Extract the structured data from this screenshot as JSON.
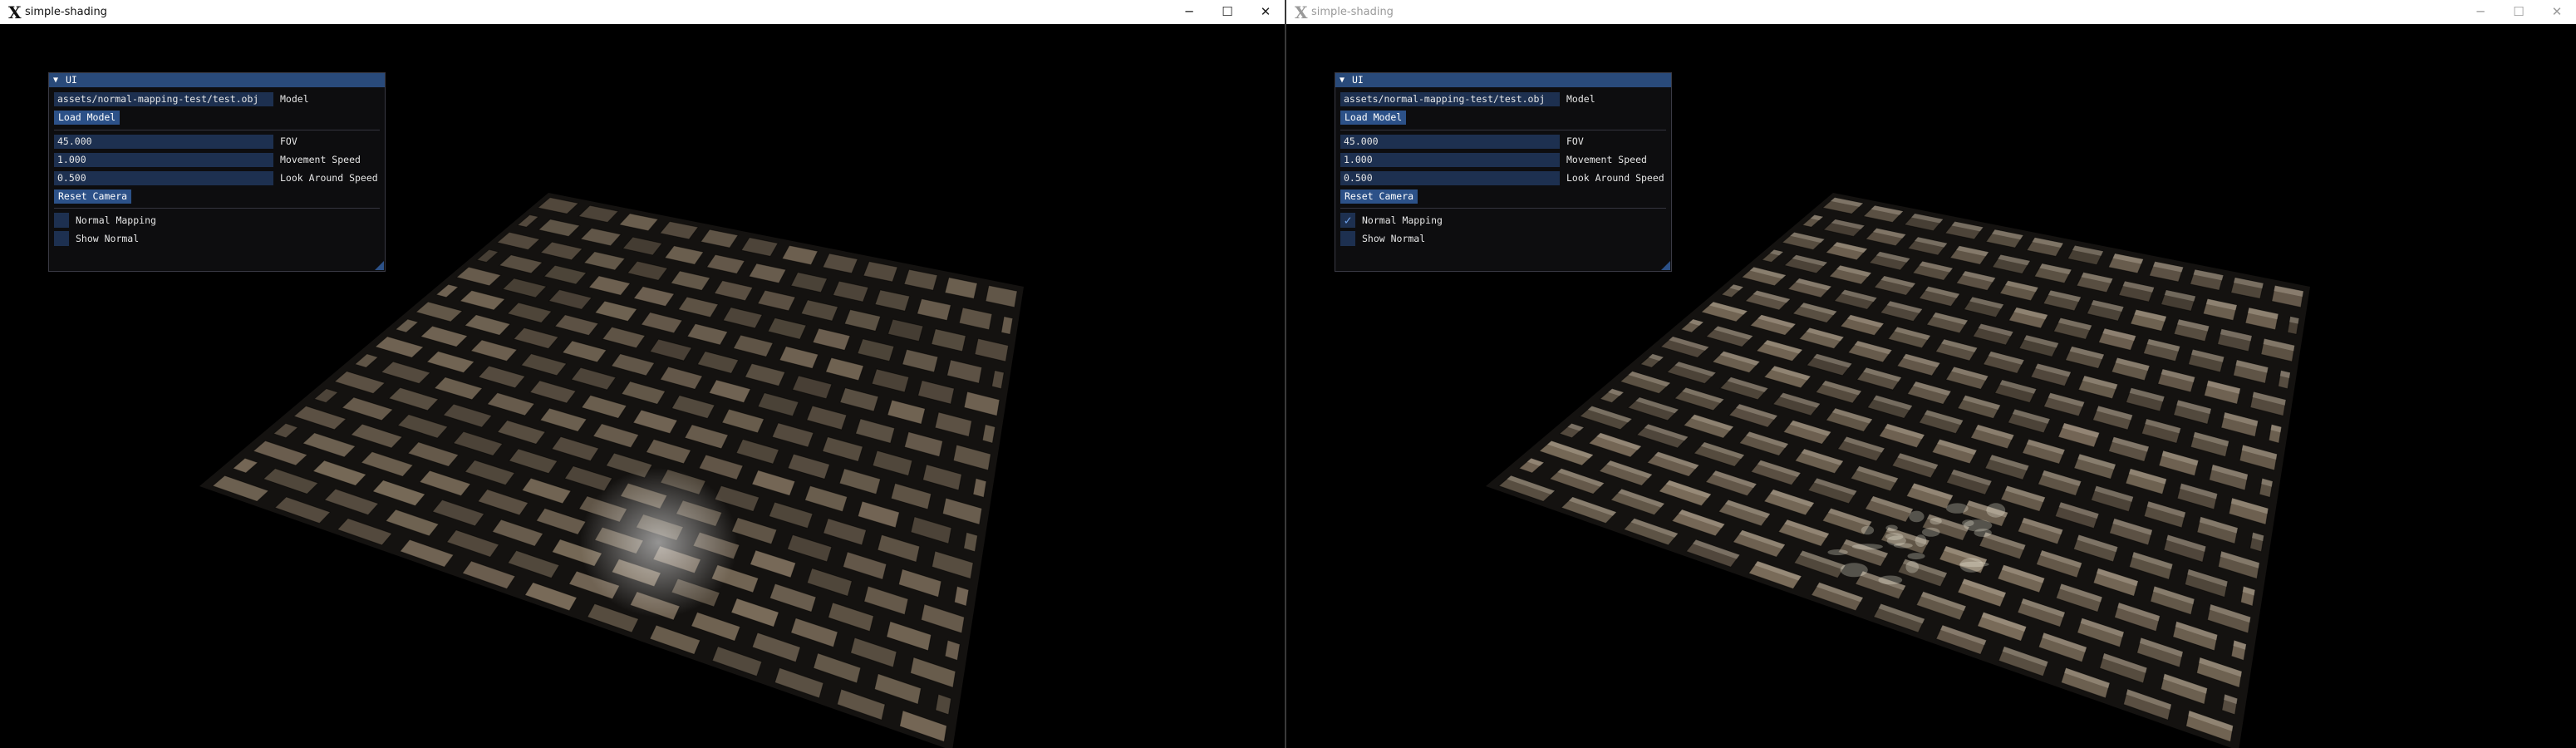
{
  "windows": [
    {
      "title": "simple-shading",
      "active": true,
      "icon": "x-logo-icon",
      "controls": {
        "minimize": "─",
        "maximize": "☐",
        "close": "✕"
      },
      "panel": {
        "title": "UI",
        "model_path": "assets/normal-mapping-test/test.obj",
        "model_label": "Model",
        "load_model_label": "Load Model",
        "fov_value": "45.000",
        "fov_label": "FOV",
        "movement_speed_value": "1.000",
        "movement_speed_label": "Movement Speed",
        "look_around_value": "0.500",
        "look_around_label": "Look Around Speed",
        "reset_camera_label": "Reset Camera",
        "normal_mapping_label": "Normal Mapping",
        "normal_mapping_checked": false,
        "show_normal_label": "Show Normal",
        "show_normal_checked": false
      }
    },
    {
      "title": "simple-shading",
      "active": false,
      "icon": "x-logo-icon",
      "controls": {
        "minimize": "─",
        "maximize": "☐",
        "close": "✕"
      },
      "panel": {
        "title": "UI",
        "model_path": "assets/normal-mapping-test/test.obj",
        "model_label": "Model",
        "load_model_label": "Load Model",
        "fov_value": "45.000",
        "fov_label": "FOV",
        "movement_speed_value": "1.000",
        "movement_speed_label": "Movement Speed",
        "look_around_value": "0.500",
        "look_around_label": "Look Around Speed",
        "reset_camera_label": "Reset Camera",
        "normal_mapping_label": "Normal Mapping",
        "normal_mapping_checked": true,
        "show_normal_label": "Show Normal",
        "show_normal_checked": false
      }
    }
  ],
  "colors": {
    "imgui_title": "#294a7a",
    "imgui_field": "#1d3050",
    "imgui_button": "#2c5188",
    "brick": "#5f5446",
    "mortar": "#141210"
  }
}
